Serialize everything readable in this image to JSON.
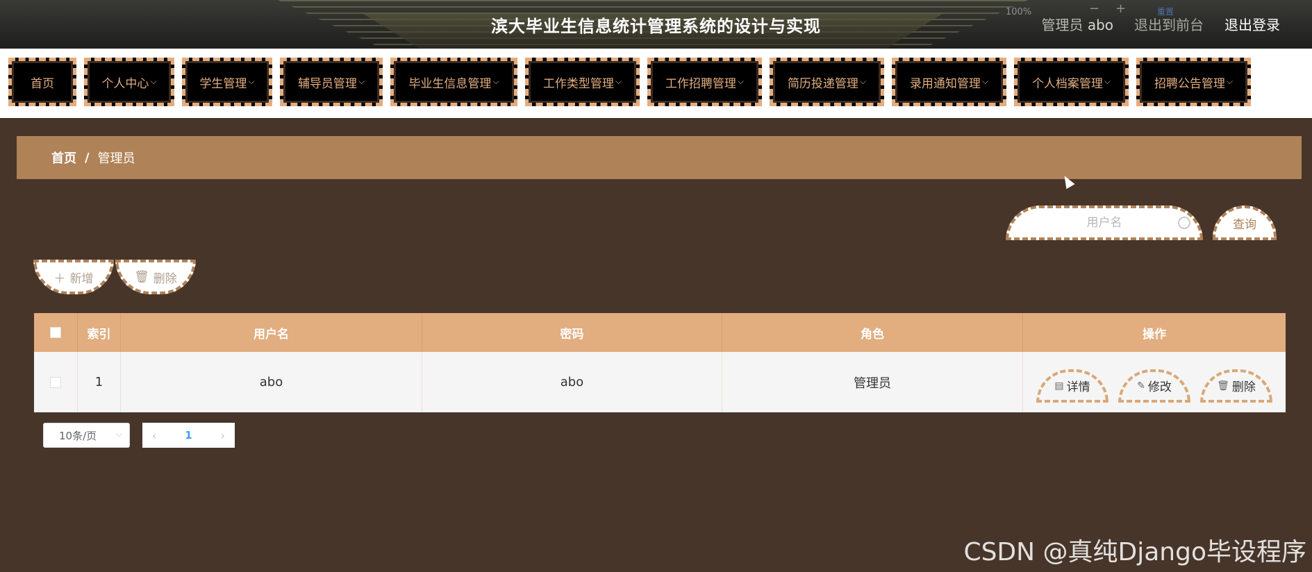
{
  "header": {
    "title": "滨大毕业生信息统计管理系统的设计与实现",
    "zoom_text": "100%",
    "zoom_minus": "−",
    "zoom_plus": "+",
    "zoom_reset": "重置",
    "role_label": "管理员",
    "username": "abo",
    "exit_front": "退出到前台",
    "logout": "退出登录"
  },
  "nav": {
    "items": [
      {
        "label": "首页",
        "has_dropdown": false
      },
      {
        "label": "个人中心",
        "has_dropdown": true
      },
      {
        "label": "学生管理",
        "has_dropdown": true
      },
      {
        "label": "辅导员管理",
        "has_dropdown": true
      },
      {
        "label": "毕业生信息管理",
        "has_dropdown": true
      },
      {
        "label": "工作类型管理",
        "has_dropdown": true
      },
      {
        "label": "工作招聘管理",
        "has_dropdown": true
      },
      {
        "label": "简历投递管理",
        "has_dropdown": true
      },
      {
        "label": "录用通知管理",
        "has_dropdown": true
      },
      {
        "label": "个人档案管理",
        "has_dropdown": true
      },
      {
        "label": "招聘公告管理",
        "has_dropdown": true
      }
    ],
    "dropdown_icon": "chevron-down-icon"
  },
  "breadcrumb": {
    "home": "首页",
    "separator": "/",
    "current": "管理员"
  },
  "search": {
    "placeholder": "用户名",
    "button_label": "查询"
  },
  "actions": {
    "add_label": "新增",
    "delete_label": "删除"
  },
  "table": {
    "columns": [
      "",
      "索引",
      "用户名",
      "密码",
      "角色",
      "操作"
    ],
    "rows": [
      {
        "index": "1",
        "username": "abo",
        "password": "abo",
        "role": "管理员"
      }
    ],
    "row_actions": {
      "detail": "详情",
      "edit": "修改",
      "delete": "删除"
    }
  },
  "pagination": {
    "page_size": "10条/页",
    "current_page": "1",
    "prev": "‹",
    "next": "›"
  },
  "watermark": "CSDN @真纯Django毕设程序",
  "colors": {
    "page_bg": "#47352a",
    "accent": "#e2ad7f",
    "breadcrumb_bg": "#b08257",
    "nav_bg": "#000000"
  }
}
